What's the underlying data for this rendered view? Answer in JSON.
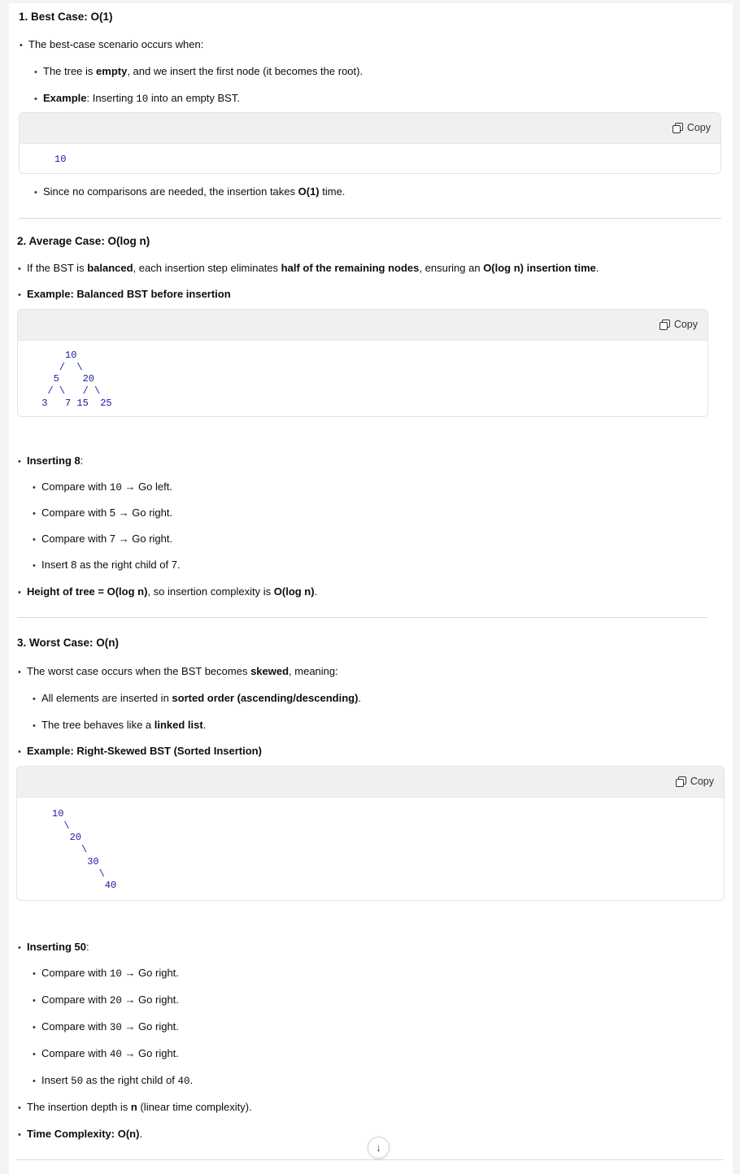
{
  "s1": {
    "title": "1. Best Case: O(1)",
    "intro": "The best-case scenario occurs when:",
    "b1_pre": "The tree is ",
    "b1_bold": "empty",
    "b1_post": ", and we insert the first node (it becomes the root).",
    "b2_bold": "Example",
    "b2_pre": ": Inserting ",
    "b2_code": "10",
    "b2_post": " into an empty BST.",
    "copy_label": "Copy",
    "code": "10",
    "b3_pre": "Since no comparisons are needed, the insertion takes ",
    "b3_bold": "O(1)",
    "b3_post": " time."
  },
  "s2": {
    "title": "2. Average Case: O(log n)",
    "l1_a": "If the BST is ",
    "l1_b": "balanced",
    "l1_c": ", each insertion step eliminates ",
    "l1_d": "half of the remaining nodes",
    "l1_e": ", ensuring an ",
    "l1_f": "O(log n) insertion time",
    "l1_g": ".",
    "l2": "Example: Balanced BST before insertion",
    "copy_label": "Copy",
    "code": "     10\n    /  \\\n   5    20\n  / \\   / \\\n 3   7 15  25",
    "l3_bold": "Inserting 8",
    "l3_post": ":",
    "steps": [
      {
        "pre": "Compare with ",
        "code": "10",
        "post": " → Go left."
      },
      {
        "pre": "Compare with 5 → Go right.",
        "code": "",
        "post": ""
      },
      {
        "pre": "Compare with 7 → Go right.",
        "code": "",
        "post": ""
      },
      {
        "pre": "Insert 8 as the right child of 7.",
        "code": "",
        "post": ""
      }
    ],
    "l4_bold": "Height of tree = O(log n)",
    "l4_mid": ", so insertion complexity is ",
    "l4_bold2": "O(log n)",
    "l4_post": "."
  },
  "s3": {
    "title": "3. Worst Case: O(n)",
    "l1_pre": "The worst case occurs when the BST becomes ",
    "l1_bold": "skewed",
    "l1_post": ", meaning:",
    "b1_pre": "All elements are inserted in ",
    "b1_bold": "sorted order (ascending/descending)",
    "b1_post": ".",
    "b2_pre": "The tree behaves like a ",
    "b2_bold": "linked list",
    "b2_post": ".",
    "l2": "Example: Right-Skewed BST (Sorted Insertion)",
    "copy_label": "Copy",
    "code": "10\n  \\\n   20\n     \\\n      30\n        \\\n         40",
    "l3_bold": "Inserting 50",
    "l3_post": ":",
    "steps": [
      {
        "pre": "Compare with ",
        "code": "10",
        "post": " → Go right."
      },
      {
        "pre": "Compare with ",
        "code": "20",
        "post": " → Go right."
      },
      {
        "pre": "Compare with ",
        "code": "30",
        "post": " → Go right."
      },
      {
        "pre": "Compare with ",
        "code": "40",
        "post": " → Go right."
      },
      {
        "pre": "Insert ",
        "code": "50",
        "post": " as the right child of ",
        "code2": "40",
        "post2": "."
      }
    ],
    "l4_pre": "The insertion depth is ",
    "l4_bold": "n",
    "l4_post": " (linear time complexity).",
    "l5": "Time Complexity: O(n)",
    "l5_post": "."
  },
  "scroll_icon": "arrow-down-icon"
}
